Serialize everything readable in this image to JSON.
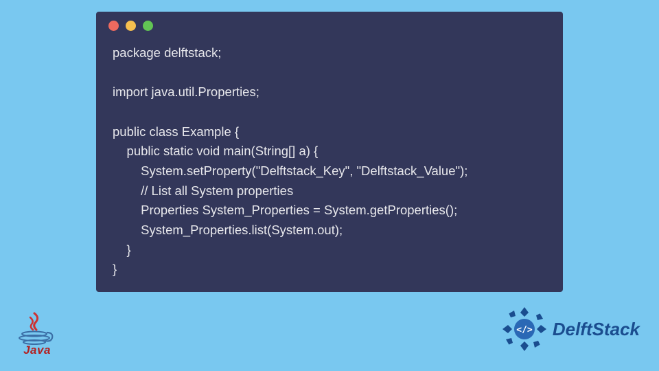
{
  "window": {
    "dots": {
      "red": "#ed6a5f",
      "yellow": "#f5bf4f",
      "green": "#62c554"
    }
  },
  "code": {
    "line1": "package delftstack;",
    "line2_blank": "",
    "line3": "import java.util.Properties;",
    "line4_blank": "",
    "line5": "public class Example {",
    "line6": "    public static void main(String[] a) {",
    "line7": "        System.setProperty(\"Delftstack_Key\", \"Delftstack_Value\");",
    "line8": "        // List all System properties",
    "line9": "        Properties System_Properties = System.getProperties();",
    "line10": "        System_Properties.list(System.out);",
    "line11": "    }",
    "line12": "}"
  },
  "java_logo": {
    "label": "Java"
  },
  "delft_logo": {
    "brand": "DelftStack"
  }
}
